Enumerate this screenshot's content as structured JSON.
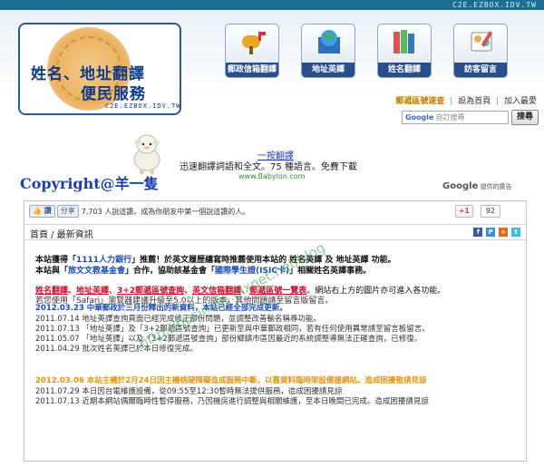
{
  "topbar": {
    "domain": "C2E.EZBOX.IDV.TW"
  },
  "logo": {
    "line1": "姓名、地址翻譯",
    "line2": "便民服務",
    "sub": "C2E.EZBOX.IDV.TW"
  },
  "nav": [
    {
      "label": "郵政信箱翻譯",
      "icon": "mailbox-icon"
    },
    {
      "label": "地址英譯",
      "icon": "globe-book-icon"
    },
    {
      "label": "姓名翻譯",
      "icon": "books-icon"
    },
    {
      "label": "訪客留言",
      "icon": "guestbook-icon"
    }
  ],
  "sublinks": {
    "zip": "郵遞區號速查",
    "homepage": "設為首頁",
    "favorite": "加入最愛",
    "sep": "|"
  },
  "search": {
    "placeholder": "自訂搜尋",
    "google": "Google",
    "button": "搜尋"
  },
  "promo": {
    "link": "一按翻譯",
    "desc": "迅速翻譯詞語和全文。75 種語言。免費下載",
    "url": "www.Babylon.com"
  },
  "copyright": "Copyright@羊一隻",
  "ads_by": {
    "prefix": "Google",
    "suffix": "提供的廣告"
  },
  "fb": {
    "like": "讚",
    "share": "分享",
    "text": "7,703 人說這讚。成為你朋友中第一個說這讚的人。"
  },
  "gplus": {
    "label": "+1",
    "count": "92"
  },
  "crumb": "首頁 / 最新資訊",
  "intro": {
    "line1_a": "本站獲得「",
    "line1_b": "1111人力銀行",
    "line1_c": "」推薦！於英文履歷繕寫時推薦使用本站的 姓名英譯 及 地址英譯 功能。",
    "line2_a": "本站與「",
    "line2_b": "旅文文教基金會",
    "line2_c": "」合作，協助該基金會「",
    "line2_d": "國際學生證(ISIC卡)",
    "line2_e": "」相關姓名英譯事務。"
  },
  "links_line": {
    "a": "姓名翻譯",
    "b": "地址英譯",
    "c": "3+2郵遞區號查詢",
    "d": "英文信箱翻譯",
    "e": "郵遞區號一覽表",
    "rest": "。網站右上方的圖片亦可進入各功能。"
  },
  "browser_note": "若您使用「Safari」瀏覽器建議升級至5.0以上的版本。其他問題請至留言版留言。",
  "news": [
    "2012.03.23 中華郵政於三月份釋出的新資料，本站已經全部完成更新。",
    "2011.07.14 地址英譯查詢頁面已經完成修正部份問題，並調整改善輸名稱尋功能。",
    "2011.07.13 「地址英譯」及「3+2郵遞區號查詢」已更新至與中華郵政相同，若有任何使用異常請至留言板留言。",
    "2011.05.07 「地址英譯」以及「3+2郵遞區號查詢」部份鄉鎮市區因最近的系統調整導無法正確查詢，已修復。",
    "2011.04.29 批次姓名英譯已於本日修復完成。"
  ],
  "notices": [
    "2012.03.06 本站主機於2月24日因主機桃硬障礙造成服務中斷，以舊資料臨時架設備援網站。造成困擾敬請見諒",
    "2011.07.29 本日因台電維護設備，從09:55至12:30暫時無法提供服務，造成困擾請見諒",
    "2011.07.13 近期本網站偶爾臨時性暫停服務，乃因機房進行調整與相關維護，至本日晚間已完成。造成困擾請見諒"
  ],
  "watermark": "http://business.pixnet.net/blog"
}
